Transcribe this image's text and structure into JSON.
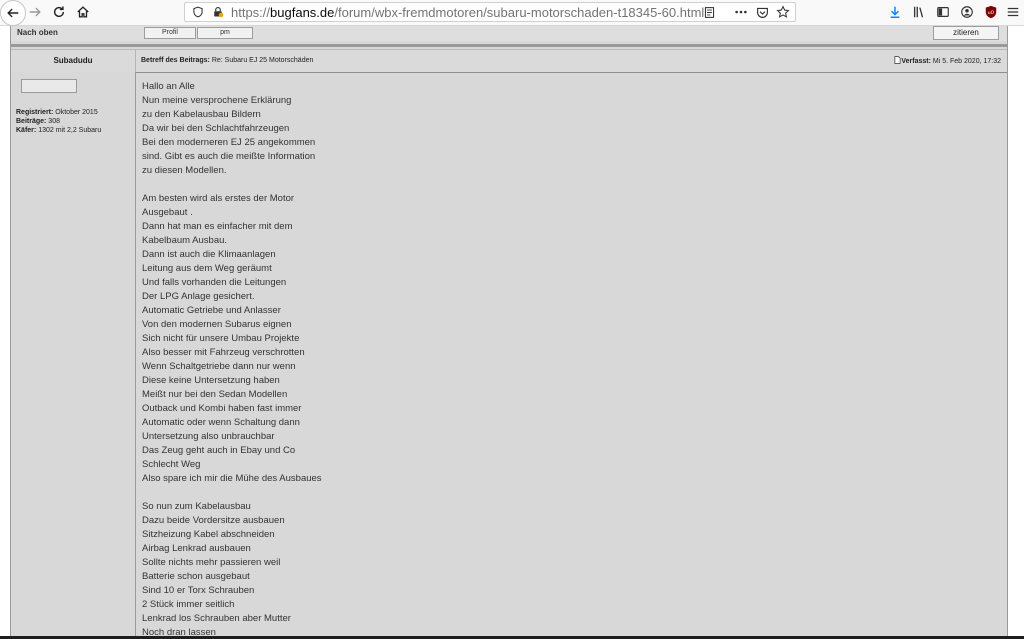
{
  "browser": {
    "url_domain": "bugfans.de",
    "url_protocol": "https://",
    "url_path": "/forum/wbx-fremdmotoren/subaru-motorschaden-t18345-60.html",
    "icons": [
      "back-icon",
      "forward-icon",
      "reload-icon",
      "home-icon",
      "tracking-shield-icon",
      "lock-icon",
      "reader-view-icon",
      "page-actions-icon",
      "pocket-icon",
      "bookmark-star-icon",
      "download-icon",
      "library-icon",
      "sidebar-icon",
      "account-icon",
      "ublock-icon",
      "menu-icon"
    ]
  },
  "prev_post": {
    "nach_oben": "Nach oben",
    "profil": "Profil",
    "pm": "pm"
  },
  "post": {
    "author": "Subadudu",
    "title_label": "Betreff des Beitrags:",
    "title_value": "Re: Subaru EJ 25 Motorschäden",
    "date_label": "Verfasst:",
    "date_value": "Mi 5. Feb 2020, 17:32",
    "quote_button": "zitieren",
    "author_info": {
      "registered_label": "Registriert:",
      "registered_value": "Oktober 2015",
      "posts_label": "Beiträge:",
      "posts_value": "308",
      "car_label": "Käfer:",
      "car_value": "1302 mit 2,2 Subaru"
    },
    "body": [
      "Hallo an Alle",
      "Nun meine versprochene Erklärung",
      "zu den Kabelausbau Bildern",
      "Da wir bei den Schlachtfahrzeugen",
      "Bei den moderneren EJ 25 angekommen",
      "sind. Gibt es auch die meißte Information",
      "zu diesen Modellen.",
      "",
      "Am besten wird als erstes der Motor",
      "Ausgebaut .",
      "Dann hat man es einfacher mit dem",
      "Kabelbaum Ausbau.",
      "Dann ist auch die Klimaanlagen",
      "Leitung aus dem Weg geräumt",
      "Und falls vorhanden die Leitungen",
      "Der LPG Anlage gesichert.",
      "Automatic Getriebe und Anlasser",
      "Von den modernen Subarus eignen",
      "Sich nicht für unsere Umbau Projekte",
      "Also besser mit Fahrzeug verschrotten",
      "Wenn Schaltgetriebe dann nur wenn",
      "Diese keine Untersetzung haben",
      "Meißt nur bei den Sedan Modellen",
      "Outback und Kombi haben fast immer",
      "Automatic oder wenn Schaltung dann",
      "Untersetzung also unbrauchbar",
      "Das Zeug geht auch in Ebay und Co",
      "Schlecht Weg",
      "Also spare ich mir die Mühe des Ausbaues",
      "",
      "So nun zum Kabelausbau",
      "Dazu beide Vordersitze ausbauen",
      "Sitzheizung Kabel abschneiden",
      "Airbag Lenkrad ausbauen",
      "Sollte nichts mehr passieren weil",
      "Batterie schon ausgebaut",
      "Sind 10 er Torx Schrauben",
      "2 Stück immer seitlich",
      "Lenkrad los Schrauben aber Mutter",
      "Noch dran lassen"
    ]
  }
}
